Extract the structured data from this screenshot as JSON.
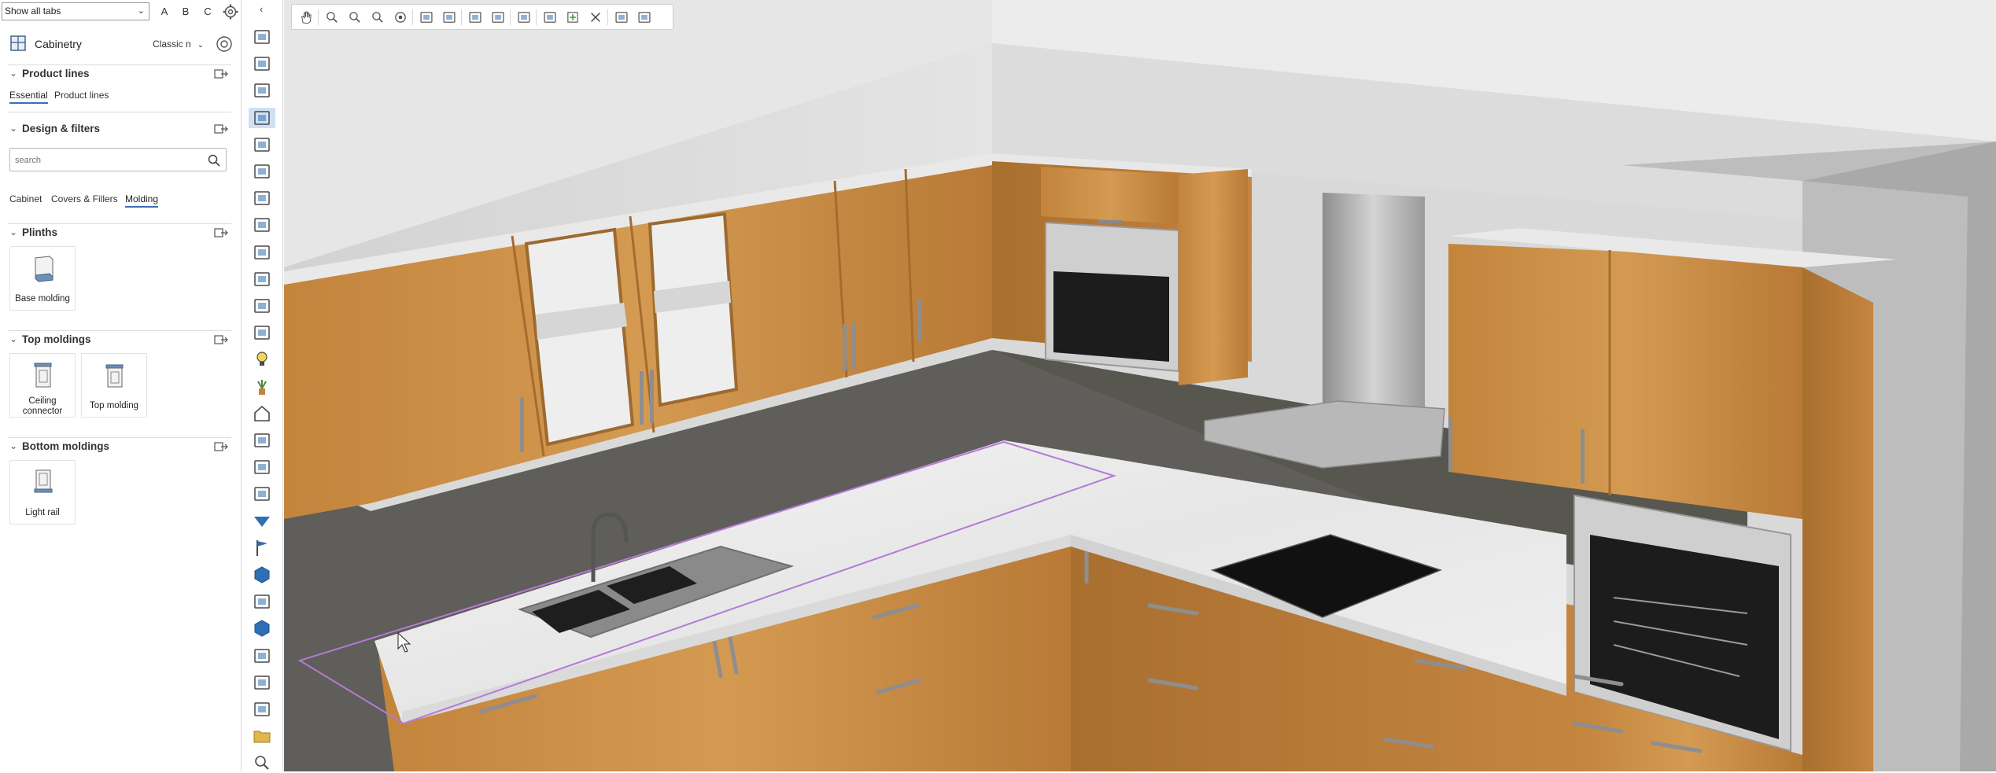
{
  "top": {
    "tabs_select": "Show all tabs",
    "view_buttons": [
      "A",
      "B",
      "C"
    ]
  },
  "library": {
    "title": "Cabinetry",
    "style_select": "Classic n"
  },
  "sections": {
    "product_lines": {
      "title": "Product lines",
      "tabs": [
        "Essential",
        "Product lines"
      ],
      "active_tab": "Essential"
    },
    "design_filters": {
      "title": "Design & filters",
      "search_placeholder": "search",
      "tabs": [
        "Cabinet",
        "Covers & Fillers",
        "Molding"
      ],
      "active_tab": "Molding"
    },
    "plinths": {
      "title": "Plinths",
      "items": [
        {
          "label": "Base molding"
        }
      ]
    },
    "top_moldings": {
      "title": "Top moldings",
      "items": [
        {
          "label": "Ceiling connector"
        },
        {
          "label": "Top molding"
        }
      ]
    },
    "bottom_moldings": {
      "title": "Bottom moldings",
      "items": [
        {
          "label": "Light rail"
        }
      ]
    }
  },
  "sidebar_tools": [
    "stove-icon",
    "tools-icon",
    "plan-icon",
    "cabinet-grid-icon",
    "arch-icon",
    "bench-icon",
    "faucet-icon",
    "shelving-icon",
    "car-icon",
    "bathtub-icon",
    "door-icon",
    "group-icon",
    "lightbulb-icon",
    "plant-icon",
    "house-icon",
    "figure-icon",
    "building-icon",
    "truck-icon",
    "triangle-icon",
    "flag-icon",
    "box-icon",
    "camera-icon",
    "cube-icon",
    "scanner-icon",
    "stairs-icon",
    "floorplan-icon",
    "folder-icon",
    "search-icon"
  ],
  "viewport_toolbar": [
    "pan-icon",
    "zoom-in-icon",
    "zoom-out-icon",
    "zoom-window-icon",
    "orbit-icon",
    "fit-all-icon",
    "fit-selection-icon",
    "select-icon",
    "layers-icon",
    "measure-icon",
    "pencil-icon",
    "add-icon",
    "delete-icon",
    "camera-icon",
    "screenshot-icon"
  ],
  "colors": {
    "accent": "#3b6fb6",
    "selection": "#b57ad6",
    "wood": "#c9893f",
    "floor": "#5f5e5a",
    "wall": "#d9d9d9"
  }
}
